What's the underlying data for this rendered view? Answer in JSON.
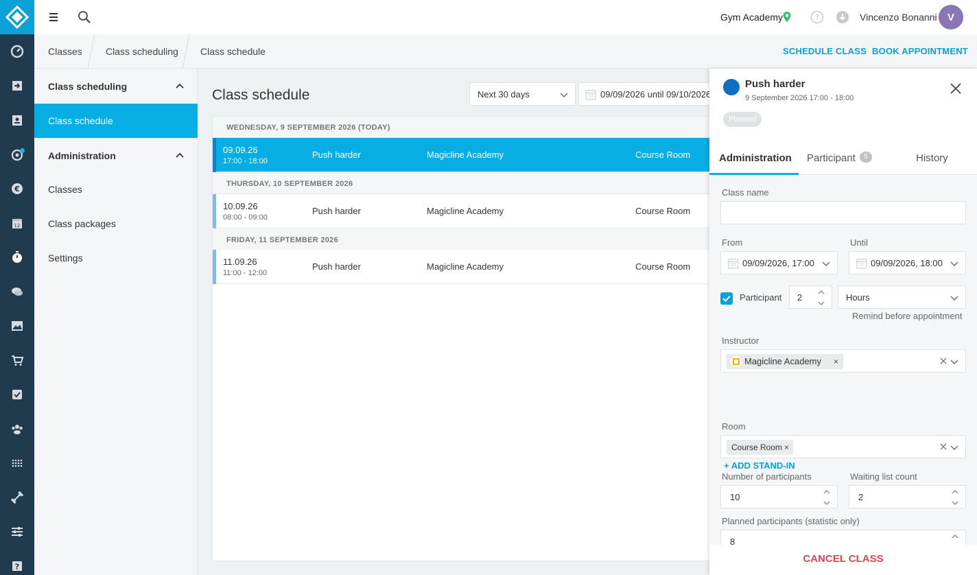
{
  "topbar": {
    "studio": "Gym Academy",
    "user_name": "Vincenzo Bonanni",
    "avatar_initial": "V"
  },
  "breadcrumb": {
    "items": [
      "Classes",
      "Class scheduling",
      "Class schedule"
    ],
    "actions": [
      "SCHEDULE CLASS",
      "BOOK APPOINTMENT"
    ]
  },
  "sidenav": {
    "group1": "Class scheduling",
    "group1_items": [
      "Class schedule"
    ],
    "group2": "Administration",
    "group2_items": [
      "Classes",
      "Class packages",
      "Settings"
    ]
  },
  "main": {
    "title": "Class schedule",
    "period": "Next 30 days",
    "range": "09/09/2026 until 09/10/2026",
    "days": [
      {
        "header": "WEDNESDAY, 9 SEPTEMBER 2026 (TODAY)",
        "date": "09.09.26",
        "time": "17:00  -  18:00",
        "class": "Push harder",
        "instructor": "Magicline Academy",
        "room": "Course Room"
      },
      {
        "header": "THURSDAY, 10 SEPTEMBER 2026",
        "date": "10.09.26",
        "time": "08:00  -  09:00",
        "class": "Push harder",
        "instructor": "Magicline Academy",
        "room": "Course Room"
      },
      {
        "header": "FRIDAY, 11 SEPTEMBER 2026",
        "date": "11.09.26",
        "time": "11:00  -  12:00",
        "class": "Push harder",
        "instructor": "Magicline Academy",
        "room": "Course Room"
      }
    ]
  },
  "panel": {
    "title": "Push harder",
    "subtitle": "9 September 2026 17:00 - 18:00",
    "status": "Planned",
    "tabs": [
      "Administration",
      "Participant",
      "History"
    ],
    "participant_count": "5",
    "class_name_label": "Class name",
    "class_name_value": "",
    "from_label": "From",
    "from_value": "09/09/2026, 17:00",
    "until_label": "Until",
    "until_value": "09/09/2026, 18:00",
    "remind_label": "Participant",
    "remind_value": "2",
    "remind_unit": "Hours",
    "remind_hint": "Remind before appointment",
    "instructor_label": "Instructor",
    "instructor_value": "Magicline Academy",
    "add_standin": "+ ADD STAND-IN",
    "room_label": "Room",
    "room_value": "Course Room",
    "participants_label": "Number of participants",
    "participants_value": "10",
    "waiting_label": "Waiting list count",
    "waiting_value": "2",
    "planned_label": "Planned participants (statistic only)",
    "planned_value": "8",
    "cancel": "CANCEL CLASS"
  },
  "colors": {
    "accent": "#06aee4",
    "rail": "#1f3b4d",
    "danger": "#d9474f",
    "avatar": "#8a75b5"
  }
}
